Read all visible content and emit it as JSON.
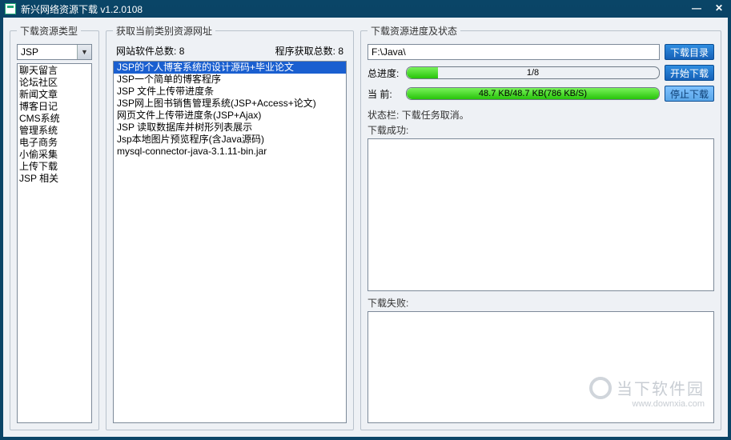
{
  "titlebar": {
    "title": "新兴网络资源下载  v1.2.0108"
  },
  "left": {
    "legend": "下载资源类型",
    "selected": "JSP",
    "items": [
      "聊天留言",
      "论坛社区",
      "新闻文章",
      "博客日记",
      "CMS系统",
      "管理系统",
      "电子商务",
      "小偷采集",
      "上传下载",
      "JSP 相关"
    ]
  },
  "mid": {
    "legend": "获取当前类别资源网址",
    "count_site_label": "网站软件总数:",
    "count_site_value": "8",
    "count_prog_label": "程序获取总数:",
    "count_prog_value": "8",
    "items": [
      "JSP的个人博客系统的设计源码+毕业论文",
      "JSP一个简单的博客程序",
      "JSP 文件上传带进度条",
      "JSP网上图书销售管理系统(JSP+Access+论文)",
      "网页文件上传带进度条(JSP+Ajax)",
      "JSP 读取数据库并树形列表展示",
      "Jsp本地图片预览程序(含Java源码)",
      "mysql-connector-java-3.1.11-bin.jar"
    ],
    "selected_index": 0
  },
  "right": {
    "legend": "下载资源进度及状态",
    "path": "F:\\Java\\",
    "btn_browse": "下载目录",
    "btn_start": "开始下载",
    "btn_stop": "停止下载",
    "total_label": "总进度:",
    "total_text": "1/8",
    "total_percent": 12.5,
    "current_label": "当  前:",
    "current_text": "48.7 KB/48.7 KB(786 KB/S)",
    "current_percent": 100,
    "status_prefix": "状态栏:",
    "status_text": "下载任务取消。",
    "success_label": "下载成功:",
    "fail_label": "下载失败:"
  },
  "watermark": {
    "name": "当下软件园",
    "url": "www.downxia.com"
  }
}
